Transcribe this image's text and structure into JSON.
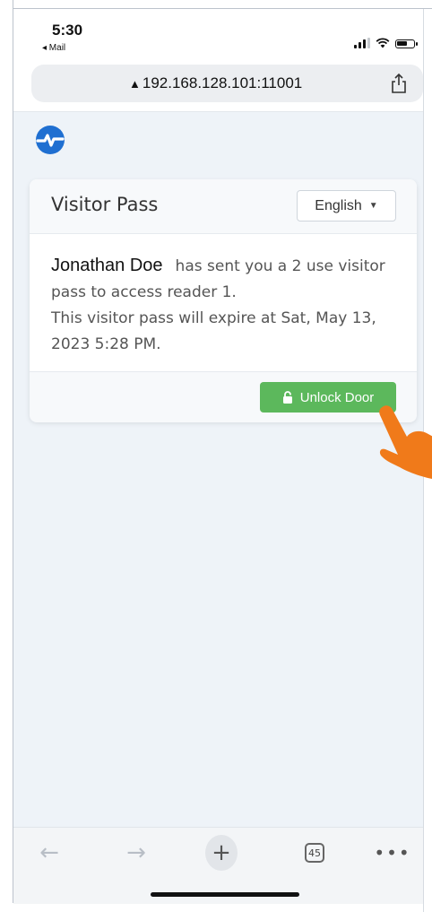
{
  "status_bar": {
    "time": "5:30",
    "back_app": "◂ Mail"
  },
  "browser": {
    "url": "192.168.128.101:11001",
    "tabs_count": "45",
    "icons": [
      "warning-triangle-icon",
      "share-icon",
      "back-arrow-icon",
      "forward-arrow-icon",
      "new-tab-plus-icon",
      "tabs-icon",
      "more-icon"
    ]
  },
  "card": {
    "title": "Visitor Pass",
    "language": "English",
    "sender": "Jonathan Doe",
    "message": "has sent you a 2 use visitor pass to access reader 1.",
    "expiry": "This visitor pass will expire at Sat, May 13, 2023 5:28 PM.",
    "unlock_label": "Unlock Door"
  },
  "colors": {
    "button_green": "#5cb85c",
    "logo_blue": "#1f6fd1",
    "page_bg": "#eef3f8",
    "pointer_orange": "#f07a1a"
  }
}
